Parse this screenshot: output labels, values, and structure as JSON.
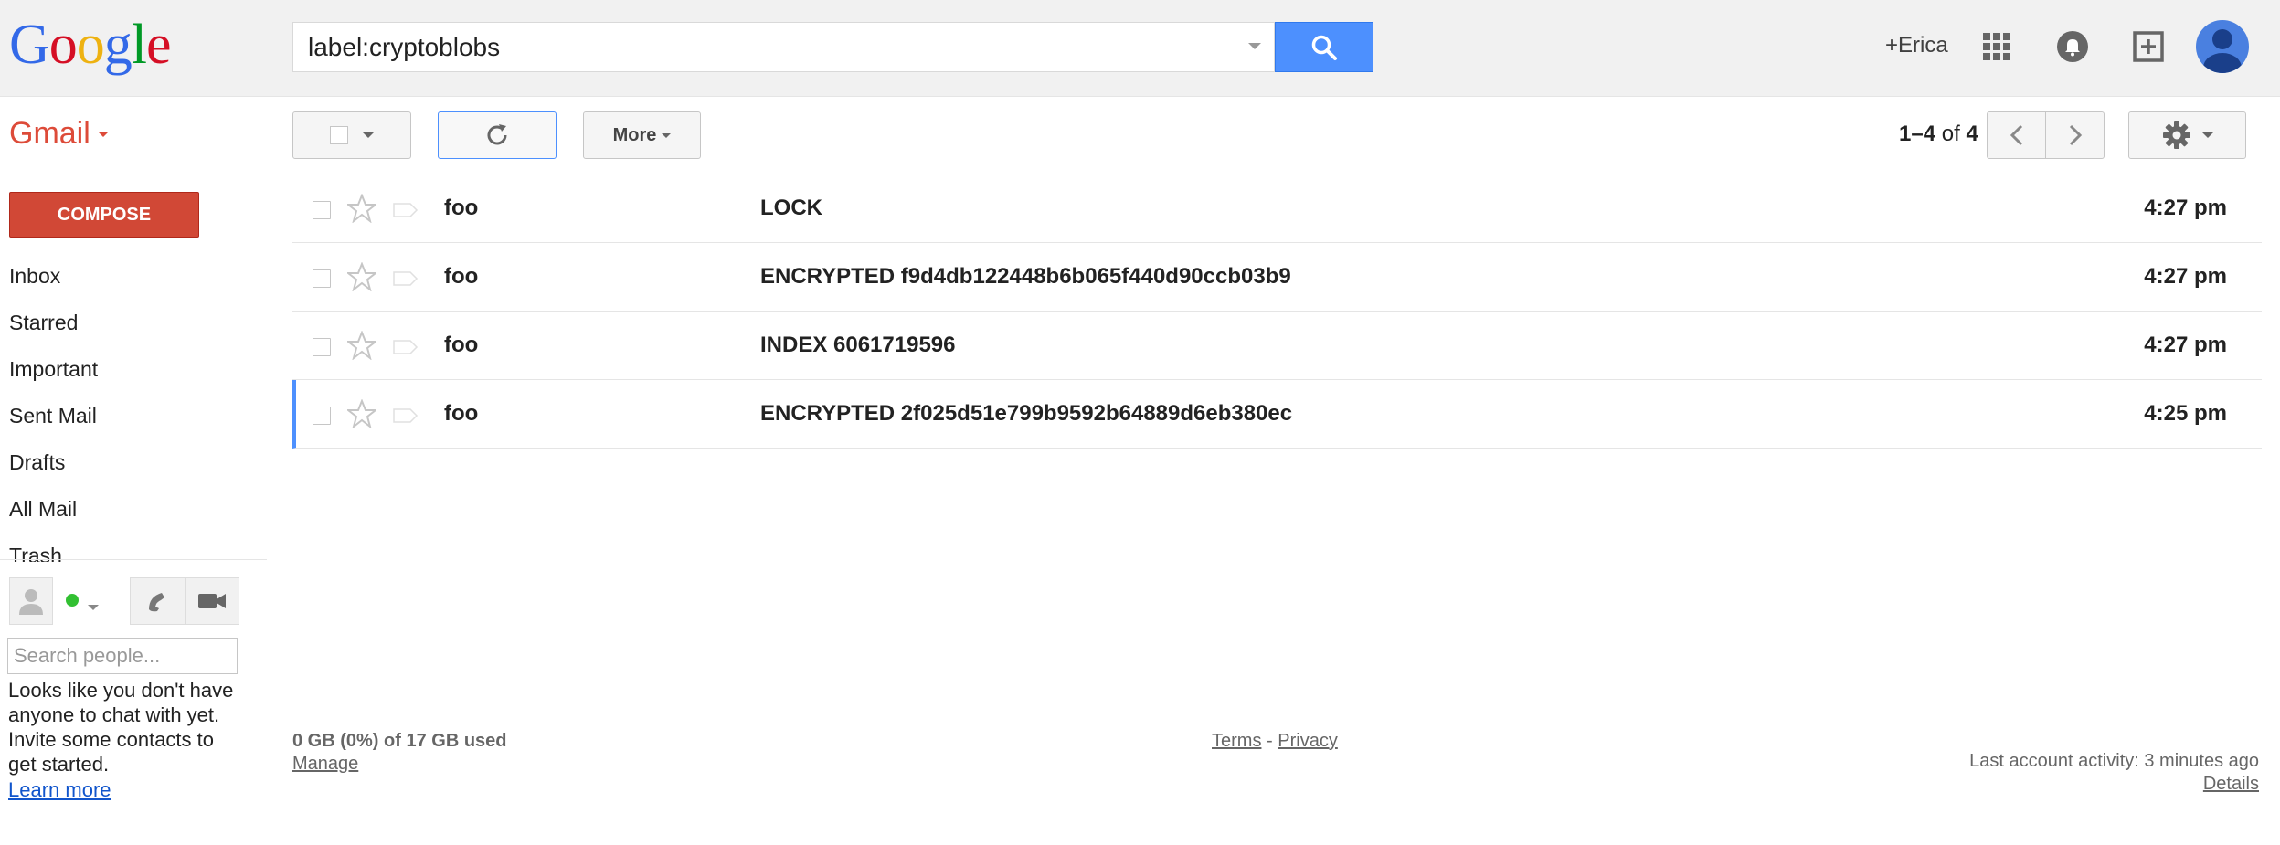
{
  "header": {
    "logo_letters": [
      {
        "char": "G",
        "color": "#3369e8"
      },
      {
        "char": "o",
        "color": "#d50f25"
      },
      {
        "char": "o",
        "color": "#eeb211"
      },
      {
        "char": "g",
        "color": "#3369e8"
      },
      {
        "char": "l",
        "color": "#009925"
      },
      {
        "char": "e",
        "color": "#d50f25"
      }
    ],
    "search_query": "label:cryptoblobs",
    "search_icon": "search-icon",
    "user_link": "+Erica",
    "apps_icon": "apps-grid-icon",
    "notifications_icon": "bell-icon",
    "share_icon": "add-box-icon",
    "avatar_icon": "person-avatar-icon"
  },
  "toolbar": {
    "app_menu_label": "Gmail",
    "more_label": "More",
    "refresh_icon": "refresh-icon",
    "settings_icon": "gear-icon",
    "pager": {
      "start": "1",
      "end": "4",
      "of_label": "of",
      "total": "4"
    }
  },
  "sidebar": {
    "compose_label": "COMPOSE",
    "items": [
      {
        "label": "Inbox"
      },
      {
        "label": "Starred"
      },
      {
        "label": "Important"
      },
      {
        "label": "Sent Mail"
      },
      {
        "label": "Drafts"
      },
      {
        "label": "All Mail"
      },
      {
        "label": "Trash"
      }
    ]
  },
  "chat": {
    "status_color": "#32c032",
    "search_placeholder": "Search people...",
    "empty_message": "Looks like you don't have anyone to chat with yet. Invite some contacts to get started.",
    "learn_more_label": "Learn more"
  },
  "messages": [
    {
      "sender": "foo",
      "subject": "LOCK",
      "date": "4:27 pm"
    },
    {
      "sender": "foo",
      "subject": "ENCRYPTED f9d4db122448b6b065f440d90ccb03b9",
      "date": "4:27 pm"
    },
    {
      "sender": "foo",
      "subject": "INDEX 6061719596",
      "date": "4:27 pm"
    },
    {
      "sender": "foo",
      "subject": "ENCRYPTED 2f025d51e799b9592b64889d6eb380ec",
      "date": "4:25 pm"
    }
  ],
  "footer": {
    "storage": "0 GB (0%) of 17 GB used",
    "manage_label": "Manage",
    "terms_label": "Terms",
    "separator": "-",
    "privacy_label": "Privacy",
    "activity": "Last account activity: 3 minutes ago",
    "details_label": "Details"
  },
  "colors": {
    "brand_red": "#dd4b39",
    "compose_red": "#d14836",
    "search_blue": "#4d90fe",
    "link_blue": "#1155cc"
  }
}
